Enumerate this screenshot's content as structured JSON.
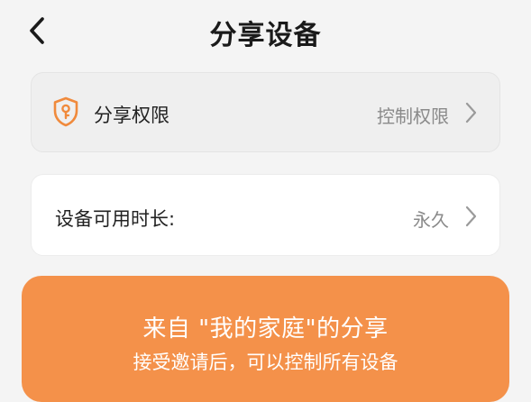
{
  "header": {
    "title": "分享设备",
    "back_icon": "chevron-left-icon"
  },
  "permission": {
    "label": "分享权限",
    "value": "控制权限",
    "icon": "shield-key-icon",
    "icon_color": "#f08a3c"
  },
  "duration": {
    "label": "设备可用时长:",
    "value": "永久"
  },
  "share": {
    "title": "来自 \"我的家庭\"的分享",
    "subtitle": "接受邀请后，可以控制所有设备",
    "background_color": "#f4914a"
  }
}
